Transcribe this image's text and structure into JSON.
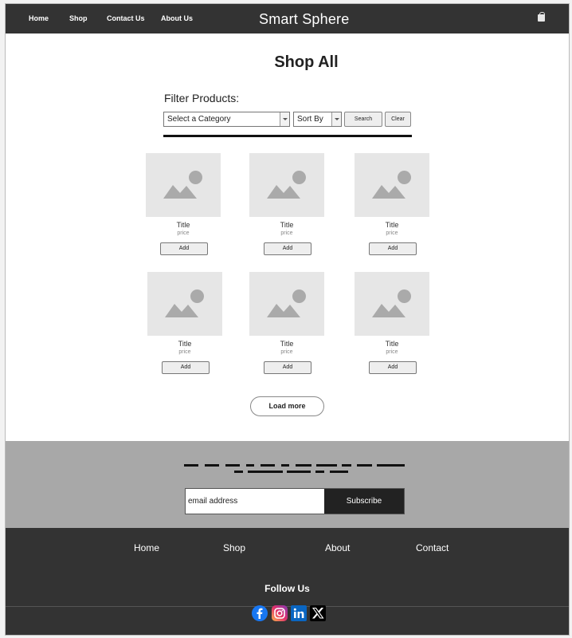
{
  "nav": {
    "links": [
      "Home",
      "Shop",
      "Contact Us",
      "About Us"
    ],
    "brand": "Smart Sphere",
    "cart_icon": "shopping-bag-icon"
  },
  "page": {
    "title": "Shop All"
  },
  "filter": {
    "label": "Filter Products:",
    "category_select": "Select a Category",
    "sort_select": "Sort By",
    "search_label": "Search",
    "clear_label": "Clear"
  },
  "products": [
    {
      "title": "Title",
      "price": "price",
      "add": "Add"
    },
    {
      "title": "Title",
      "price": "price",
      "add": "Add"
    },
    {
      "title": "Title",
      "price": "price",
      "add": "Add"
    },
    {
      "title": "Title",
      "price": "price",
      "add": "Add"
    },
    {
      "title": "Title",
      "price": "price",
      "add": "Add"
    },
    {
      "title": "Title",
      "price": "price",
      "add": "Add"
    }
  ],
  "load_more": "Load more",
  "newsletter": {
    "email_placeholder": "email address",
    "subscribe_label": "Subscribe"
  },
  "footer": {
    "links": [
      "Home",
      "Shop",
      "About",
      "Contact"
    ],
    "follow_label": "Follow Us",
    "social": [
      "facebook-icon",
      "instagram-icon",
      "linkedin-icon",
      "x-icon"
    ]
  },
  "colors": {
    "nav_bg": "#333333",
    "newsletter_bg": "#a8a8a8",
    "placeholder_bg": "#e6e6e6",
    "facebook": "#1877f2",
    "linkedin": "#0a66c2"
  }
}
